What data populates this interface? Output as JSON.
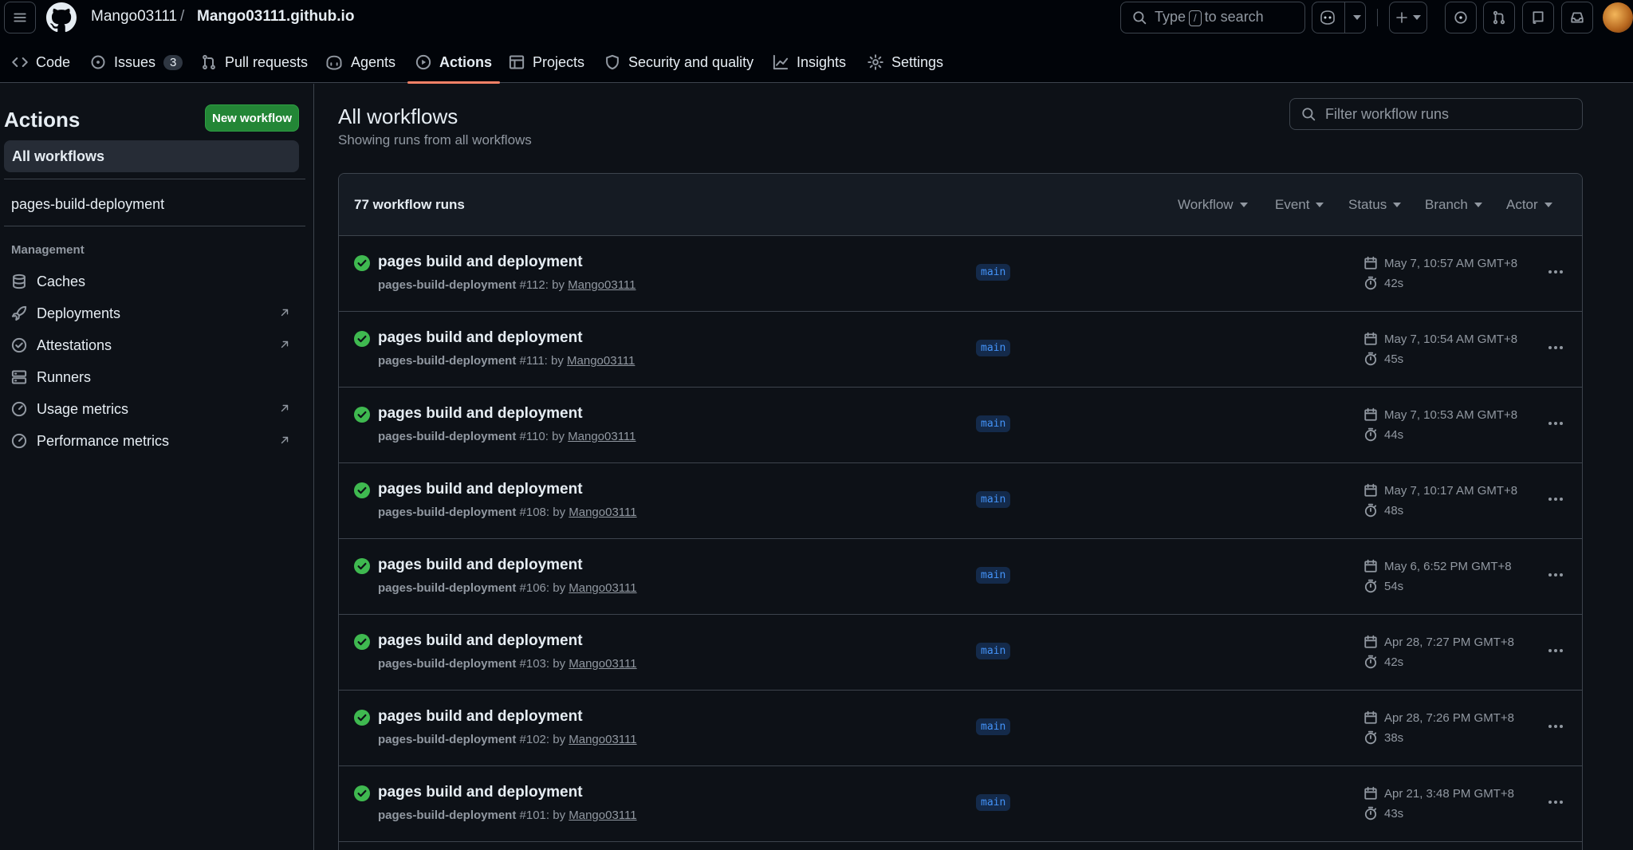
{
  "header": {
    "owner": "Mango03111",
    "separator": "/",
    "repo": "Mango03111.github.io",
    "search": {
      "prefix": "Type",
      "key": "/",
      "suffix": "to search"
    }
  },
  "tabs": [
    {
      "label": "Code",
      "icon": "code-icon"
    },
    {
      "label": "Issues",
      "icon": "issue-icon",
      "count": "3"
    },
    {
      "label": "Pull requests",
      "icon": "pull-request-icon"
    },
    {
      "label": "Agents",
      "icon": "agent-icon"
    },
    {
      "label": "Actions",
      "icon": "play-icon",
      "active": true
    },
    {
      "label": "Projects",
      "icon": "table-icon"
    },
    {
      "label": "Security and quality",
      "icon": "shield-icon"
    },
    {
      "label": "Insights",
      "icon": "graph-icon"
    },
    {
      "label": "Settings",
      "icon": "gear-icon"
    }
  ],
  "sidebar": {
    "title": "Actions",
    "new_workflow": "New workflow",
    "all_workflows": "All workflows",
    "workflows": [
      "pages-build-deployment"
    ],
    "management_heading": "Management",
    "management": [
      {
        "label": "Caches",
        "icon": "database-icon",
        "external": false
      },
      {
        "label": "Deployments",
        "icon": "rocket-icon",
        "external": true
      },
      {
        "label": "Attestations",
        "icon": "verified-icon",
        "external": true
      },
      {
        "label": "Runners",
        "icon": "server-icon",
        "external": false
      },
      {
        "label": "Usage metrics",
        "icon": "meter-icon",
        "external": true
      },
      {
        "label": "Performance metrics",
        "icon": "meter-icon",
        "external": true
      }
    ]
  },
  "main": {
    "title": "All workflows",
    "subtitle": "Showing runs from all workflows",
    "filter_placeholder": "Filter workflow runs",
    "runs_count": "77 workflow runs",
    "filters": [
      "Workflow",
      "Event",
      "Status",
      "Branch",
      "Actor"
    ],
    "runs": [
      {
        "title": "pages build and deployment",
        "workflow": "pages-build-deployment",
        "number": "#112",
        "by": ": by",
        "actor": "Mango03111",
        "branch": "main",
        "date": "May 7, 10:57 AM GMT+8",
        "duration": "42s",
        "status": "success"
      },
      {
        "title": "pages build and deployment",
        "workflow": "pages-build-deployment",
        "number": "#111",
        "by": ": by",
        "actor": "Mango03111",
        "branch": "main",
        "date": "May 7, 10:54 AM GMT+8",
        "duration": "45s",
        "status": "success"
      },
      {
        "title": "pages build and deployment",
        "workflow": "pages-build-deployment",
        "number": "#110",
        "by": ": by",
        "actor": "Mango03111",
        "branch": "main",
        "date": "May 7, 10:53 AM GMT+8",
        "duration": "44s",
        "status": "success"
      },
      {
        "title": "pages build and deployment",
        "workflow": "pages-build-deployment",
        "number": "#108",
        "by": ": by",
        "actor": "Mango03111",
        "branch": "main",
        "date": "May 7, 10:17 AM GMT+8",
        "duration": "48s",
        "status": "success"
      },
      {
        "title": "pages build and deployment",
        "workflow": "pages-build-deployment",
        "number": "#106",
        "by": ": by",
        "actor": "Mango03111",
        "branch": "main",
        "date": "May 6, 6:52 PM GMT+8",
        "duration": "54s",
        "status": "success"
      },
      {
        "title": "pages build and deployment",
        "workflow": "pages-build-deployment",
        "number": "#103",
        "by": ": by",
        "actor": "Mango03111",
        "branch": "main",
        "date": "Apr 28, 7:27 PM GMT+8",
        "duration": "42s",
        "status": "success"
      },
      {
        "title": "pages build and deployment",
        "workflow": "pages-build-deployment",
        "number": "#102",
        "by": ": by",
        "actor": "Mango03111",
        "branch": "main",
        "date": "Apr 28, 7:26 PM GMT+8",
        "duration": "38s",
        "status": "success"
      },
      {
        "title": "pages build and deployment",
        "workflow": "pages-build-deployment",
        "number": "#101",
        "by": ": by",
        "actor": "Mango03111",
        "branch": "main",
        "date": "Apr 21, 3:48 PM GMT+8",
        "duration": "43s",
        "status": "success"
      }
    ]
  },
  "colors": {
    "success": "#3fb950",
    "accent_tab": "#f78166",
    "green_button": "#238636",
    "branch_text": "#4493f8"
  }
}
